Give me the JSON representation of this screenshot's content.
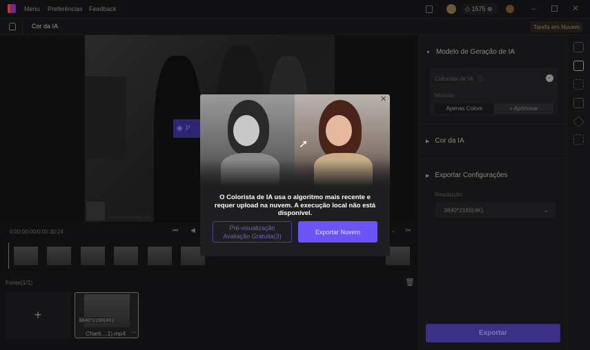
{
  "topbar": {
    "menu": "Menu",
    "preferences": "Preferências",
    "feedback": "Feedback",
    "credits": "1575"
  },
  "navbar": {
    "title": "Cor da IA",
    "cloud_task": "Tarefa em Nuvem"
  },
  "preview": {
    "button": "P",
    "watermark": "The Kid in Flop Expert T.S.S."
  },
  "timeline": {
    "time": "0:00:00:00/0:00:30:24"
  },
  "source": {
    "label": "Fonte(1/1)",
    "clip_resolution": "3840*2160(4K)",
    "clip_name": "Charli....1).mp4"
  },
  "panel": {
    "model_section": "Modelo de Geração de IA",
    "colorist": "Colorista de IA",
    "model_label": "Modelo:",
    "model_options": [
      "Apenas Colorir",
      "+ Aprimorar"
    ],
    "color_section": "Cor da IA",
    "export_section": "Exportar Configurações",
    "resolution_label": "Resolução",
    "resolution_value": "3840*2160(4K)",
    "export_button": "Exportar"
  },
  "modal": {
    "message": "O Colorista de IA usa o algoritmo mais recente e requer upload na nuvem. A execução local não está disponível.",
    "preview_button_line1": "Pré-visualização",
    "preview_button_line2": "Avaliação Gratuita(3)",
    "export_cloud_button": "Exportar Nuvem"
  },
  "colors": {
    "accent": "#6b54f5",
    "export_button": "#3b2f86"
  }
}
